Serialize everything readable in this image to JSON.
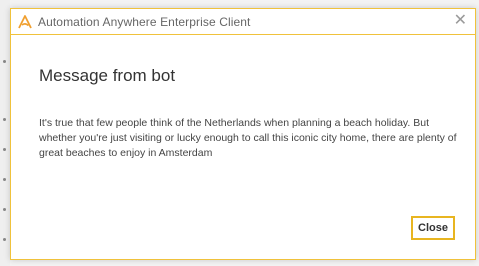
{
  "window": {
    "title": "Automation Anywhere Enterprise Client",
    "close_glyph": "✕"
  },
  "icons": {
    "app_logo": "automation-anywhere-logo-icon",
    "close": "close-icon"
  },
  "colors": {
    "accent": "#f0c23b",
    "logo": "#f0a030"
  },
  "message": {
    "heading": "Message from bot",
    "body": "It's true that few people think of the Netherlands when planning a beach holiday. But whether you're just visiting or lucky enough to call this iconic city home, there are plenty of great beaches to enjoy in Amsterdam"
  },
  "buttons": {
    "close_label": "Close"
  }
}
